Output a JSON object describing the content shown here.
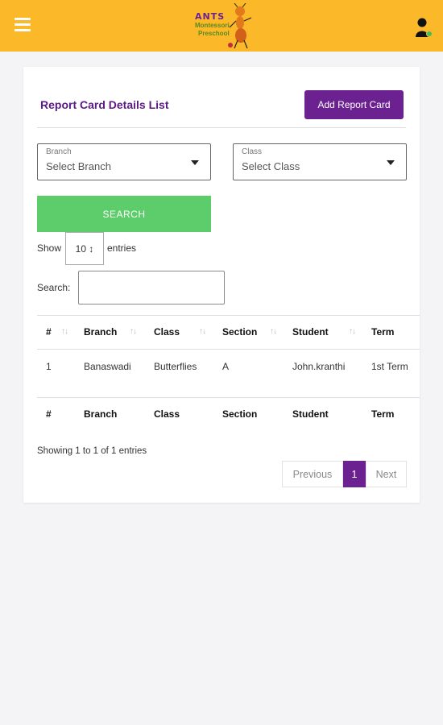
{
  "header": {
    "logo": {
      "name": "ANTS",
      "line2": "Montessori",
      "line3": "Preschool"
    }
  },
  "main": {
    "title": "Report Card Details List",
    "add_button": "Add Report Card",
    "branch_select": {
      "label": "Branch",
      "value": "Select Branch"
    },
    "class_select": {
      "label": "Class",
      "value": "Select Class"
    },
    "search_button": "SEARCH",
    "show_label": "Show",
    "entries_value": "10 ↕",
    "entries_label": "entries",
    "search_label": "Search:",
    "search_value": ""
  },
  "table": {
    "columns": [
      "#",
      "Branch",
      "Class",
      "Section",
      "Student",
      "Term"
    ],
    "rows": [
      [
        "1",
        "Banaswadi",
        "Butterflies",
        "A",
        "John.kranthi",
        "1st Term"
      ]
    ],
    "footer_columns": [
      "#",
      "Branch",
      "Class",
      "Section",
      "Student",
      "Term"
    ]
  },
  "pagination": {
    "info": "Showing 1 to 1 of 1 entries",
    "previous": "Previous",
    "current": "1",
    "next": "Next"
  },
  "colors": {
    "header": "#fbb829",
    "accent": "#6b2290",
    "search": "#5dcc6b"
  }
}
